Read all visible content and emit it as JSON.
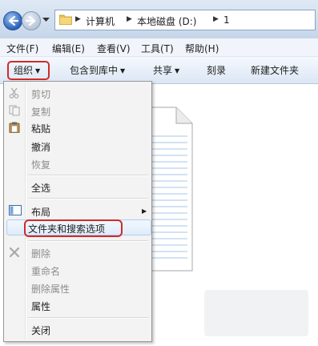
{
  "window": {
    "breadcrumb": [
      "计算机",
      "本地磁盘 (D:)",
      "1"
    ],
    "icons": {
      "back": "back-arrow-icon",
      "forward": "forward-arrow-icon",
      "history": "chevron-down-icon",
      "folder": "folder-icon"
    }
  },
  "menubar": {
    "items": [
      "文件(F)",
      "编辑(E)",
      "查看(V)",
      "工具(T)",
      "帮助(H)"
    ]
  },
  "toolbar": {
    "organize": "组织",
    "include_library": "包含到库中",
    "share": "共享",
    "burn": "刻录",
    "new_folder": "新建文件夹"
  },
  "context_menu": {
    "items": [
      {
        "label": "剪切",
        "enabled": false,
        "icon": "scissors-icon"
      },
      {
        "label": "复制",
        "enabled": false,
        "icon": "copy-icon"
      },
      {
        "label": "粘贴",
        "enabled": true,
        "icon": "paste-icon"
      },
      {
        "label": "撤消",
        "enabled": true
      },
      {
        "label": "恢复",
        "enabled": false
      },
      {
        "label": "全选",
        "enabled": true
      },
      {
        "label": "布局",
        "enabled": true,
        "icon": "layout-icon",
        "has_submenu": true
      },
      {
        "label": "文件夹和搜索选项",
        "enabled": true,
        "highlighted": true
      },
      {
        "label": "删除",
        "enabled": false,
        "icon": "delete-icon"
      },
      {
        "label": "重命名",
        "enabled": false
      },
      {
        "label": "删除属性",
        "enabled": false
      },
      {
        "label": "属性",
        "enabled": true
      },
      {
        "label": "关闭",
        "enabled": true
      }
    ]
  },
  "colors": {
    "highlight_border": "#d12a2a",
    "disabled_text": "#8d8d8d"
  }
}
